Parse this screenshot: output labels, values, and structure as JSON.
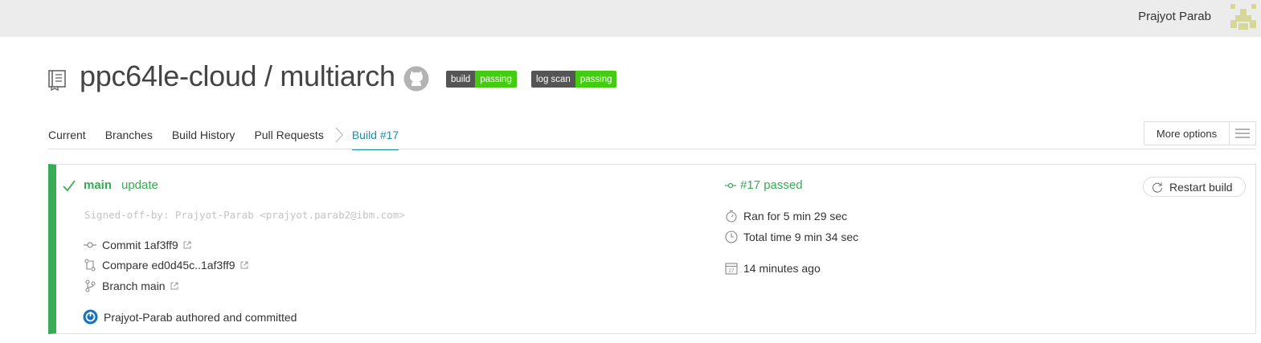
{
  "topbar": {
    "user_name": "Prajyot Parab"
  },
  "repo": {
    "title": "ppc64le-cloud / multiarch",
    "badges": [
      {
        "left": "build",
        "right": "passing",
        "color": "#44cc11"
      },
      {
        "left": "log scan",
        "right": "passing",
        "color": "#44cc11"
      }
    ]
  },
  "tabs": {
    "current": "Current",
    "branches": "Branches",
    "history": "Build History",
    "pulls": "Pull Requests",
    "build": "Build #17"
  },
  "more_options": {
    "label": "More options"
  },
  "build": {
    "branch": "main",
    "message": "update",
    "signoff": "Signed-off-by: Prajyot-Parab <prajyot.parab2@ibm.com>",
    "commit": "Commit 1af3ff9",
    "compare": "Compare ed0d45c..1af3ff9",
    "branch_link": "Branch main",
    "author": "Prajyot-Parab authored and committed",
    "status": "#17 passed",
    "ran_for": "Ran for 5 min 29 sec",
    "total_time": "Total time 9 min 34 sec",
    "calendar_day": "27",
    "ago": "14 minutes ago",
    "restart": "Restart build"
  },
  "colors": {
    "passed": "#39aa56",
    "active_tab": "#1f8fa6",
    "badge_green": "#44cc11",
    "badge_dark": "#555555"
  }
}
